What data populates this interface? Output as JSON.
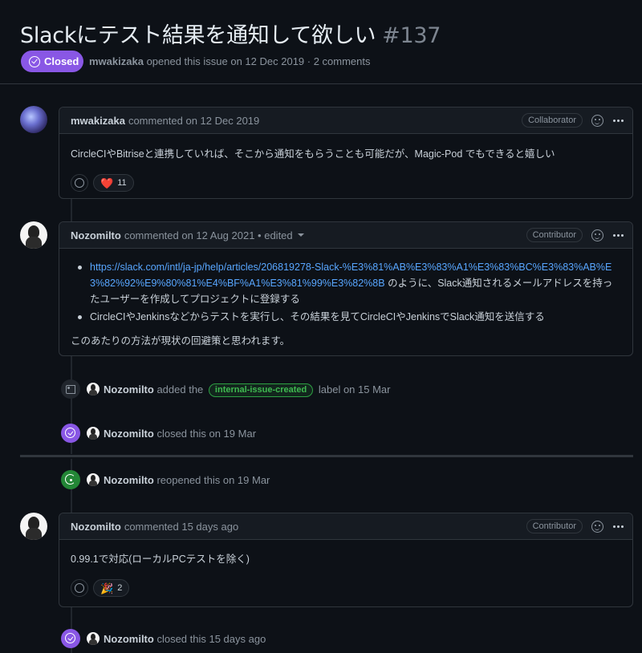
{
  "issue": {
    "title": "Slackにテスト結果を通知して欲しい",
    "number": "#137",
    "state": "Closed",
    "author": "mwakizaka",
    "meta_text": "opened this issue on 12 Dec 2019 · 2 comments"
  },
  "comments": [
    {
      "author": "mwakizaka",
      "meta": "commented on 12 Dec 2019",
      "role": "Collaborator",
      "body": "CircleCIやBitriseと連携していれば、そこから通知をもらうことも可能だが、Magic-Pod でもできると嬉しい",
      "reaction": {
        "emoji": "❤️",
        "count": "11"
      }
    },
    {
      "author": "Nozomilto",
      "meta": "commented on 12 Aug 2021 • edited",
      "role": "Contributor",
      "bullet1_link": "https://slack.com/intl/ja-jp/help/articles/206819278-Slack-%E3%81%AB%E3%83%A1%E3%83%BC%E3%83%AB%E3%82%92%E9%80%81%E4%BF%A1%E3%81%99%E3%82%8B",
      "bullet1_rest": " のように、Slack通知されるメールアドレスを持ったユーザーを作成してプロジェクトに登録する",
      "bullet2": "CircleCIやJenkinsなどからテストを実行し、その結果を見てCircleCIやJenkinsでSlack通知を送信する",
      "paragraph": "このあたりの方法が現状の回避策と思われます。"
    },
    {
      "author": "Nozomilto",
      "meta": "commented 15 days ago",
      "role": "Contributor",
      "body": "0.99.1で対応(ローカルPCテストを除く)",
      "reaction": {
        "emoji": "🎉",
        "count": "2"
      }
    }
  ],
  "events": {
    "labeled": {
      "actor": "Nozomilto",
      "pre": "added the",
      "label": "internal-issue-created",
      "post": "label on 15 Mar"
    },
    "closed1": {
      "actor": "Nozomilto",
      "text": "closed this on 19 Mar"
    },
    "reopened": {
      "actor": "Nozomilto",
      "text": "reopened this on 19 Mar"
    },
    "closed2": {
      "actor": "Nozomilto",
      "text": "closed this 15 days ago"
    }
  },
  "colors": {
    "closed_purple": "#8957e5",
    "reopen_green": "#238636",
    "link_blue": "#58a6ff",
    "label_green": "#3fb950"
  }
}
